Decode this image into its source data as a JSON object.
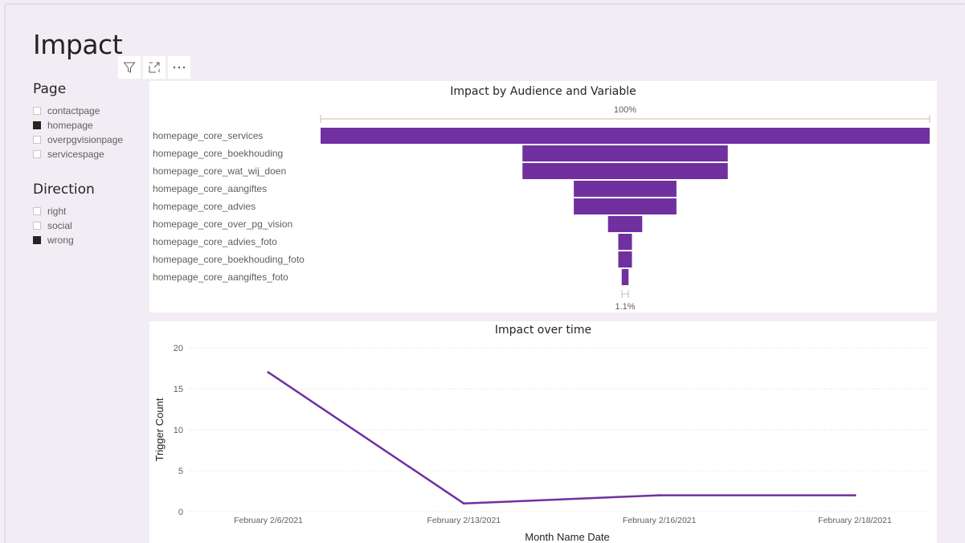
{
  "page": {
    "title": "Impact"
  },
  "toolbar": {
    "filter_icon": "filter-icon",
    "focus_icon": "focus-mode-icon",
    "more_icon": "more-options-icon"
  },
  "slicers": {
    "page": {
      "title": "Page",
      "items": [
        {
          "label": "contactpage",
          "checked": false
        },
        {
          "label": "homepage",
          "checked": true
        },
        {
          "label": "overpgvisionpage",
          "checked": false
        },
        {
          "label": "servicespage",
          "checked": false
        }
      ]
    },
    "direction": {
      "title": "Direction",
      "items": [
        {
          "label": "right",
          "checked": false
        },
        {
          "label": "social",
          "checked": false
        },
        {
          "label": "wrong",
          "checked": true
        }
      ]
    }
  },
  "colors": {
    "accent": "#7030a0",
    "canvas": "#f2edf4",
    "panel": "#ffffff"
  },
  "chart_data": [
    {
      "type": "funnel",
      "title": "Impact by Audience and Variable",
      "top_label": "100%",
      "bottom_label": "1.1%",
      "categories": [
        "homepage_core_services",
        "homepage_core_boekhouding",
        "homepage_core_wat_wij_doen",
        "homepage_core_aangiftes",
        "homepage_core_advies",
        "homepage_core_over_pg_vision",
        "homepage_core_advies_foto",
        "homepage_core_boekhouding_foto",
        "homepage_core_aangiftes_foto"
      ],
      "values": [
        89,
        30,
        30,
        15,
        15,
        5,
        2,
        2,
        1
      ]
    },
    {
      "type": "line",
      "title": "Impact over time",
      "xlabel": "Month Name Date",
      "ylabel": "Trigger Count",
      "ylim": [
        0,
        20
      ],
      "yticks": [
        "0",
        "5",
        "10",
        "15",
        "20"
      ],
      "categories": [
        "February 2/6/2021",
        "February 2/13/2021",
        "February 2/16/2021",
        "February 2/18/2021"
      ],
      "values": [
        17,
        1,
        2,
        2
      ]
    }
  ]
}
